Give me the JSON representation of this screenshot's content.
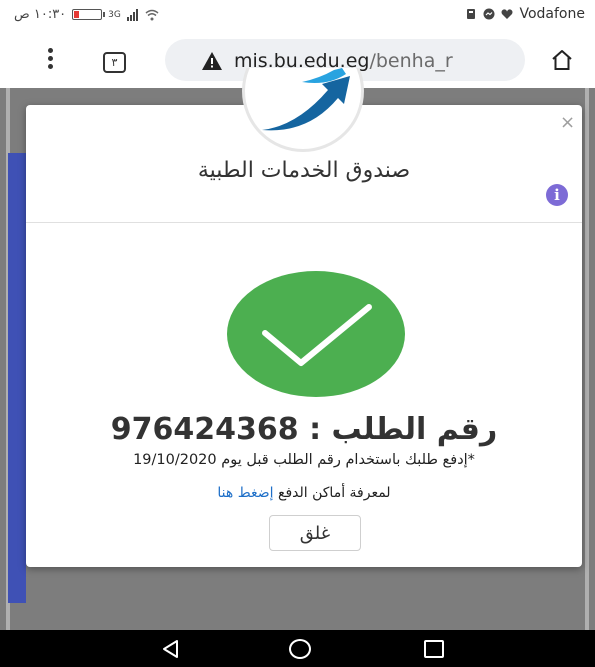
{
  "status_bar": {
    "time": "١٠:٣٠ ص",
    "network": "3G",
    "carrier": "Vodafone"
  },
  "browser": {
    "tab_count": "٣",
    "url_host": "mis.bu.edu.eg",
    "url_path": "/benha_r"
  },
  "modal": {
    "close_symbol": "×",
    "title": "صندوق الخدمات الطبية",
    "info_symbol": "i",
    "order_label": "رقم الطلب :",
    "order_number": "976424368",
    "pay_note": "*إدفع طلبك باستخدام رقم الطلب قبل يوم 19/10/2020",
    "pay_places_text": "لمعرفة أماكن الدفع",
    "pay_places_link": "إضغط هنا",
    "close_button": "غلق"
  },
  "colors": {
    "success": "#4caf50",
    "link": "#1e6fc8",
    "info": "#7d6bd6",
    "sidebar": "#3f51b5"
  },
  "icons": [
    "menu-dots-icon",
    "tab-switcher-icon",
    "warning-icon",
    "home-icon",
    "logo-arrow-icon",
    "close-icon",
    "info-icon",
    "checkmark-icon",
    "back-icon",
    "circle-home-icon",
    "recents-icon"
  ]
}
